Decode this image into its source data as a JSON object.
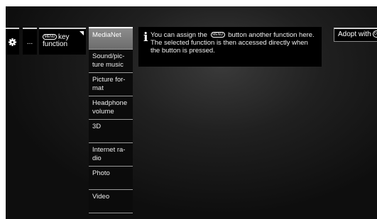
{
  "breadcrumb": {
    "gear_icon": "gear-icon",
    "ellipsis": "...",
    "key_button_glyph": "MENU",
    "key_label_line1": "key",
    "key_label_line2": "function"
  },
  "menu": {
    "items": [
      {
        "label": "MediaNet",
        "selected": true
      },
      {
        "label": "Sound/pic-ture music",
        "selected": false
      },
      {
        "label": "Picture for-mat",
        "selected": false
      },
      {
        "label": "Headphone volume",
        "selected": false
      },
      {
        "label": "3D",
        "selected": false
      },
      {
        "label": "Internet ra-dio",
        "selected": false
      },
      {
        "label": "Photo",
        "selected": false
      },
      {
        "label": "Video",
        "selected": false
      }
    ]
  },
  "info": {
    "icon": "i",
    "text_before": "You can assign the",
    "button_glyph": "MENU",
    "text_after": "button another function here. The selected function is then accessed directly when the button is pressed."
  },
  "adopt": {
    "label": "Adopt with",
    "ok_glyph": "OK"
  }
}
